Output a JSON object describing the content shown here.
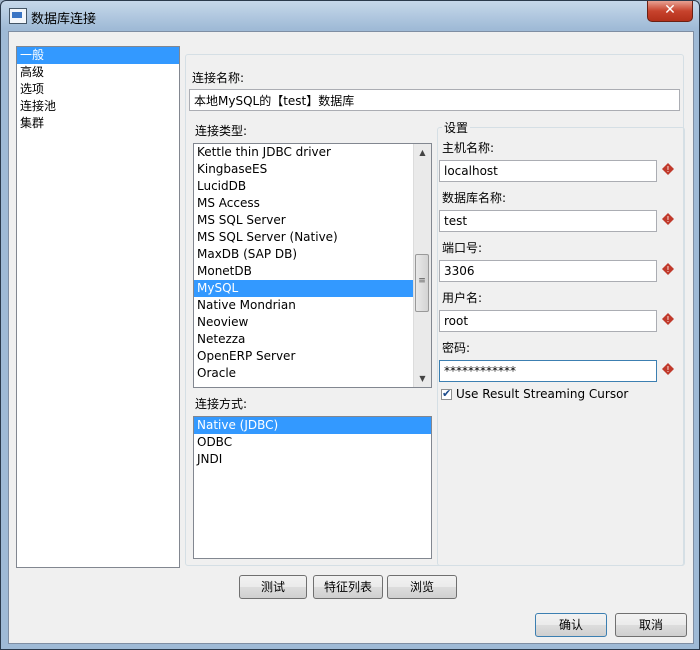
{
  "window": {
    "title": "数据库连接",
    "close_glyph": "✕"
  },
  "nav": {
    "items": [
      {
        "label": "一般",
        "selected": true
      },
      {
        "label": "高级",
        "selected": false
      },
      {
        "label": "选项",
        "selected": false
      },
      {
        "label": "连接池",
        "selected": false
      },
      {
        "label": "集群",
        "selected": false
      }
    ]
  },
  "connection": {
    "name_label": "连接名称:",
    "name_value": "本地MySQL的【test】数据库",
    "type_label": "连接类型:",
    "types": [
      {
        "label": "Kettle thin JDBC driver",
        "selected": false
      },
      {
        "label": "KingbaseES",
        "selected": false
      },
      {
        "label": "LucidDB",
        "selected": false
      },
      {
        "label": "MS Access",
        "selected": false
      },
      {
        "label": "MS SQL Server",
        "selected": false
      },
      {
        "label": "MS SQL Server (Native)",
        "selected": false
      },
      {
        "label": "MaxDB (SAP DB)",
        "selected": false
      },
      {
        "label": "MonetDB",
        "selected": false
      },
      {
        "label": "MySQL",
        "selected": true
      },
      {
        "label": "Native Mondrian",
        "selected": false
      },
      {
        "label": "Neoview",
        "selected": false
      },
      {
        "label": "Netezza",
        "selected": false
      },
      {
        "label": "OpenERP Server",
        "selected": false
      },
      {
        "label": "Oracle",
        "selected": false
      }
    ],
    "access_label": "连接方式:",
    "access_methods": [
      {
        "label": "Native (JDBC)",
        "selected": true
      },
      {
        "label": "ODBC",
        "selected": false
      },
      {
        "label": "JNDI",
        "selected": false
      }
    ]
  },
  "settings": {
    "group_label": "设置",
    "host_label": "主机名称:",
    "host_value": "localhost",
    "db_label": "数据库名称:",
    "db_value": "test",
    "port_label": "端口号:",
    "port_value": "3306",
    "user_label": "用户名:",
    "user_value": "root",
    "password_label": "密码:",
    "password_value": "************",
    "streaming_label": "Use Result Streaming Cursor",
    "streaming_checked": true,
    "required_icon": "required-diamond-icon"
  },
  "buttons": {
    "test": "测试",
    "features": "特征列表",
    "browse": "浏览",
    "ok": "确认",
    "cancel": "取消"
  },
  "colors": {
    "selection": "#3399ff",
    "required_icon": "#c0392b"
  }
}
